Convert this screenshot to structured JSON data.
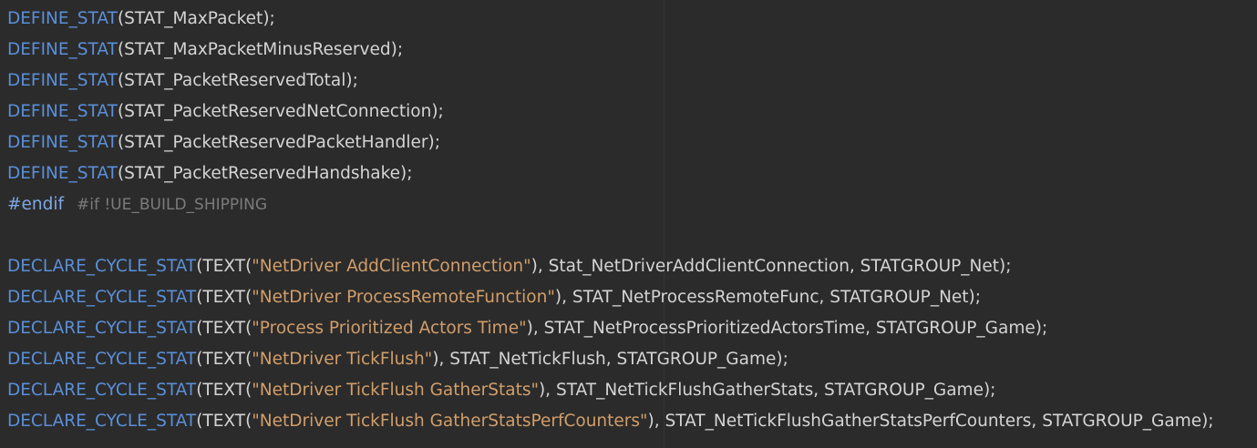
{
  "editor": {
    "lines": [
      {
        "kind": "define",
        "macro": "DEFINE_STAT",
        "open": "(",
        "arg": "STAT_MaxPacket",
        "close": ");"
      },
      {
        "kind": "define",
        "macro": "DEFINE_STAT",
        "open": "(",
        "arg": "STAT_MaxPacketMinusReserved",
        "close": ");"
      },
      {
        "kind": "define",
        "macro": "DEFINE_STAT",
        "open": "(",
        "arg": "STAT_PacketReservedTotal",
        "close": ");"
      },
      {
        "kind": "define",
        "macro": "DEFINE_STAT",
        "open": "(",
        "arg": "STAT_PacketReservedNetConnection",
        "close": ");"
      },
      {
        "kind": "define",
        "macro": "DEFINE_STAT",
        "open": "(",
        "arg": "STAT_PacketReservedPacketHandler",
        "close": ");"
      },
      {
        "kind": "define",
        "macro": "DEFINE_STAT",
        "open": "(",
        "arg": "STAT_PacketReservedHandshake",
        "close": ");"
      },
      {
        "kind": "directive",
        "directive": "#endif",
        "comment": "#if !UE_BUILD_SHIPPING"
      },
      {
        "kind": "blank"
      },
      {
        "kind": "declare",
        "macro": "DECLARE_CYCLE_STAT",
        "text_open": "(TEXT(",
        "string": "\"NetDriver AddClientConnection\"",
        "rest": "), Stat_NetDriverAddClientConnection, STATGROUP_Net);"
      },
      {
        "kind": "declare",
        "macro": "DECLARE_CYCLE_STAT",
        "text_open": "(TEXT(",
        "string": "\"NetDriver ProcessRemoteFunction\"",
        "rest": "), STAT_NetProcessRemoteFunc, STATGROUP_Net);"
      },
      {
        "kind": "declare",
        "macro": "DECLARE_CYCLE_STAT",
        "text_open": "(TEXT(",
        "string": "\"Process Prioritized Actors Time\"",
        "rest": "), STAT_NetProcessPrioritizedActorsTime, STATGROUP_Game);"
      },
      {
        "kind": "declare",
        "macro": "DECLARE_CYCLE_STAT",
        "text_open": "(TEXT(",
        "string": "\"NetDriver TickFlush\"",
        "rest": "), STAT_NetTickFlush, STATGROUP_Game);"
      },
      {
        "kind": "declare",
        "macro": "DECLARE_CYCLE_STAT",
        "text_open": "(TEXT(",
        "string": "\"NetDriver TickFlush GatherStats\"",
        "rest": "), STAT_NetTickFlushGatherStats, STATGROUP_Game);"
      },
      {
        "kind": "declare",
        "macro": "DECLARE_CYCLE_STAT",
        "text_open": "(TEXT(",
        "string": "\"NetDriver TickFlush GatherStatsPerfCounters\"",
        "rest": "), STAT_NetTickFlushGatherStatsPerfCounters, STATGROUP_Game);"
      }
    ]
  },
  "colors": {
    "background": "#2b2b2b",
    "macro": "#5a8fd8",
    "plain": "#d4d4d4",
    "string": "#d29e6a",
    "comment": "#7b7b7b"
  }
}
